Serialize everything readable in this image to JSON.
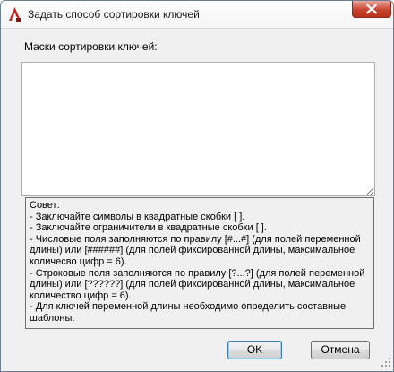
{
  "window": {
    "title": "Задать способ сортировки ключей"
  },
  "masks": {
    "label": "Маски сортировки ключей:",
    "value": ""
  },
  "tip": {
    "lines": [
      "Совет:",
      "  - Заключайте символы в квадратные скобки [ ].",
      "  - Заключайте ограничители в квадратные скобки [ ].",
      "  - Числовые поля заполняются по правилу [#...#] (для полей переменной",
      "длины) или [######] (для полей фиксированной длины, максимальное",
      "количесво цифр = 6).",
      "  - Строковые поля заполняются по правилу [?...?] (для полей переменной",
      "длины) или  [??????] (для полей фиксированной длины, максимальное",
      "количество цифр = 6).",
      "  - Для ключей переменной длины необходимо определить составные",
      "шаблоны."
    ]
  },
  "buttons": {
    "ok": "OK",
    "cancel": "Отмена"
  },
  "icons": {
    "app": "autocad-icon",
    "close": "close-icon",
    "grip": "resize-grip-icon"
  },
  "colors": {
    "close_red": "#c8442f",
    "app_red": "#c0281e"
  }
}
